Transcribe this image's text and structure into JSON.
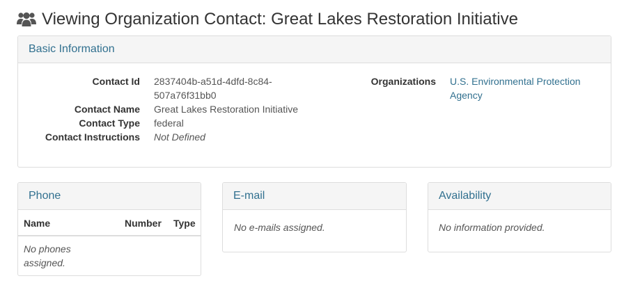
{
  "page": {
    "title": "Viewing Organization Contact: Great Lakes Restoration Initiative",
    "icon": "users-icon"
  },
  "basic": {
    "heading": "Basic Information",
    "contact_id_label": "Contact Id",
    "contact_id_line1": "2837404b-a51d-4dfd-8c84-",
    "contact_id_line2": "507a76f31bb0",
    "contact_name_label": "Contact Name",
    "contact_name": "Great Lakes Restoration Initiative",
    "contact_type_label": "Contact Type",
    "contact_type": "federal",
    "contact_instructions_label": "Contact Instructions",
    "contact_instructions": "Not Defined",
    "organizations_label": "Organizations",
    "organization_line1": "U.S. Environmental Protection",
    "organization_line2": "Agency"
  },
  "phone": {
    "heading": "Phone",
    "columns": [
      "Name",
      "Number",
      "Type"
    ],
    "empty_line1": "No phones",
    "empty_line2": "assigned."
  },
  "email": {
    "heading": "E-mail",
    "empty": "No e-mails assigned."
  },
  "availability": {
    "heading": "Availability",
    "empty": "No information provided."
  },
  "colors": {
    "heading_text": "#31708f",
    "heading_bg": "#f5f5f5",
    "border": "#dddddd",
    "link": "#31708f"
  }
}
